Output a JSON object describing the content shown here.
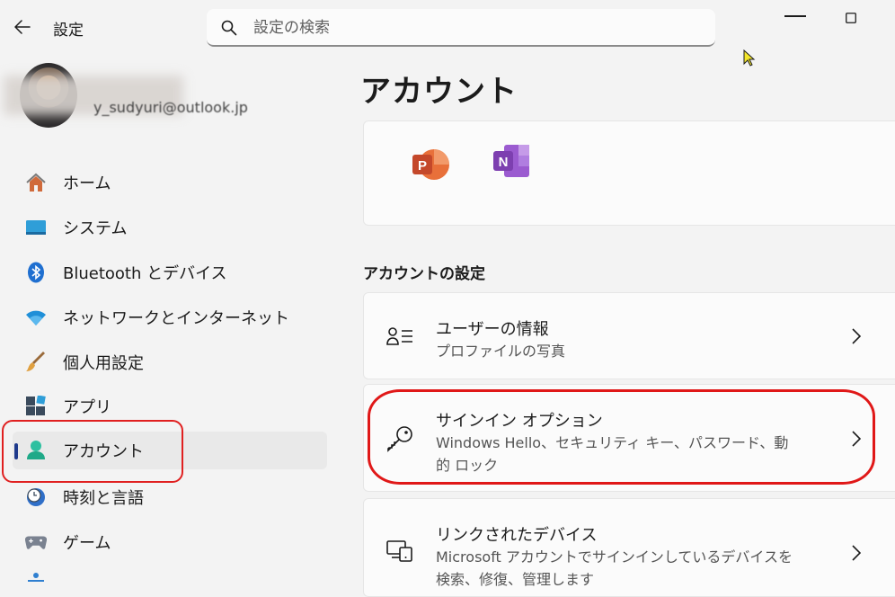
{
  "titlebar": {
    "app_title": "設定",
    "search_placeholder": "設定の検索"
  },
  "profile": {
    "email": "y_sudyuri@outlook.jp"
  },
  "nav": {
    "items": [
      {
        "label": "ホーム",
        "icon": "home-icon"
      },
      {
        "label": "システム",
        "icon": "system-icon"
      },
      {
        "label": "Bluetooth とデバイス",
        "icon": "bluetooth-icon"
      },
      {
        "label": "ネットワークとインターネット",
        "icon": "wifi-icon"
      },
      {
        "label": "個人用設定",
        "icon": "brush-icon"
      },
      {
        "label": "アプリ",
        "icon": "apps-icon"
      },
      {
        "label": "アカウント",
        "icon": "account-icon",
        "active": true
      },
      {
        "label": "時刻と言語",
        "icon": "clock-globe-icon"
      },
      {
        "label": "ゲーム",
        "icon": "gamepad-icon"
      }
    ]
  },
  "content": {
    "title": "アカウント",
    "apps": [
      {
        "icon": "powerpoint-icon",
        "letter": "P",
        "color": "#c4482a"
      },
      {
        "icon": "onenote-icon",
        "letter": "N",
        "color": "#7d3fb0"
      }
    ],
    "section_heading": "アカウントの設定",
    "settings": [
      {
        "title": "ユーザーの情報",
        "desc": "プロファイルの写真",
        "icon": "user-info-icon"
      },
      {
        "title": "サインイン オプション",
        "desc": "Windows Hello、セキュリティ キー、パスワード、動的 ロック",
        "icon": "key-icon"
      },
      {
        "title": "リンクされたデバイス",
        "desc": "Microsoft アカウントでサインインしているデバイスを検索、修復、管理します",
        "icon": "devices-icon"
      }
    ]
  },
  "colors": {
    "accent": "#1f3a8c",
    "highlight_ring": "#e02020"
  }
}
